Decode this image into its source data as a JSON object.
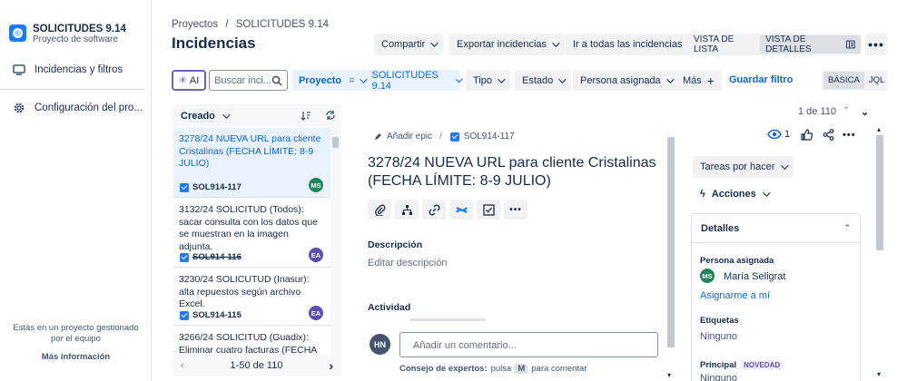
{
  "sidebar": {
    "project_name": "SOLICITUDES 9.14",
    "project_type": "Proyecto de software",
    "items": [
      {
        "label": "Incidencias y filtros"
      },
      {
        "label": "Configuración del pro..."
      }
    ],
    "footer_text": "Estás en un proyecto gestionado por el equipo",
    "footer_link": "Más información"
  },
  "header": {
    "breadcrumb_1": "Proyectos",
    "breadcrumb_sep": "/",
    "breadcrumb_2": "SOLICITUDES 9.14",
    "title": "Incidencias",
    "share": "Compartir",
    "export": "Exportar incidencias",
    "all_issues": "Ir a todas las incidencias",
    "view_list": "VISTA DE LISTA",
    "view_detail": "VISTA DE DETALLES"
  },
  "filters": {
    "ai": "AI",
    "search_placeholder": "Buscar inci...",
    "project_label": "Proyecto",
    "project_op": "=",
    "project_value": "SOLICITUDES 9.14",
    "type": "Tipo",
    "status": "Estado",
    "assignee": "Persona asignada",
    "more": "Más",
    "save": "Guardar filtro",
    "basic": "BÁSICA",
    "jql": "JQL"
  },
  "list": {
    "sort_label": "Creado",
    "pagination": "1-50 de 110",
    "cards": [
      {
        "title": "3278/24 NUEVA URL para cliente Cristalinas (FECHA LÍMITE: 8-9 JULIO)",
        "key": "SOL914-117",
        "avatar": "MS",
        "avatar_color": "#1f845a",
        "done": false
      },
      {
        "title": "3132/24 SOLICITUD (Todos): sacar consulta con los datos que se muestran en la imagen adjunta.",
        "key": "SOL914-116",
        "avatar": "EA",
        "avatar_color": "#5e4db2",
        "done": true
      },
      {
        "title": "3230/24 SOLICUTUD (Inasur): alta repuestos según archivo Excel.",
        "key": "SOL914-115",
        "avatar": "EA",
        "avatar_color": "#5e4db2",
        "done": false
      },
      {
        "title": "3266/24 SOLICITUD (Guadix): Eliminar cuatro facturas (FECHA",
        "key": "",
        "avatar": "",
        "avatar_color": "#5e4db2",
        "done": false
      }
    ]
  },
  "detail": {
    "counter": "1 de 110",
    "add_epic": "Añadir epic",
    "key": "SOL914-117",
    "title": "3278/24 NUEVA URL para cliente Cristalinas (FECHA LÍMITE: 8-9 JULIO)",
    "description_label": "Descripción",
    "description_placeholder": "Editar descripción",
    "activity_label": "Actividad",
    "comment_avatar": "HN",
    "comment_placeholder": "Añadir un comentario...",
    "tip_prefix": "Consejo de expertos:",
    "tip_mid": "pulsa",
    "tip_key": "M",
    "tip_suffix": "para comentar",
    "watchers": "1",
    "status_button": "Tareas por hacer",
    "actions": "Acciones",
    "details_header": "Detalles",
    "assignee_label": "Persona asignada",
    "assignee_avatar": "MS",
    "assignee_name": "María Seligrat",
    "assign_me": "Asignarme a mí",
    "labels_label": "Etiquetas",
    "labels_value": "Ninguno",
    "principal_label": "Principal",
    "principal_badge": "NOVEDAD",
    "principal_value": "Ninguno"
  },
  "colors": {
    "accent": "#0c66e4",
    "selected_bg": "#e9f2ff",
    "ai_border": "#6e5dc6"
  }
}
